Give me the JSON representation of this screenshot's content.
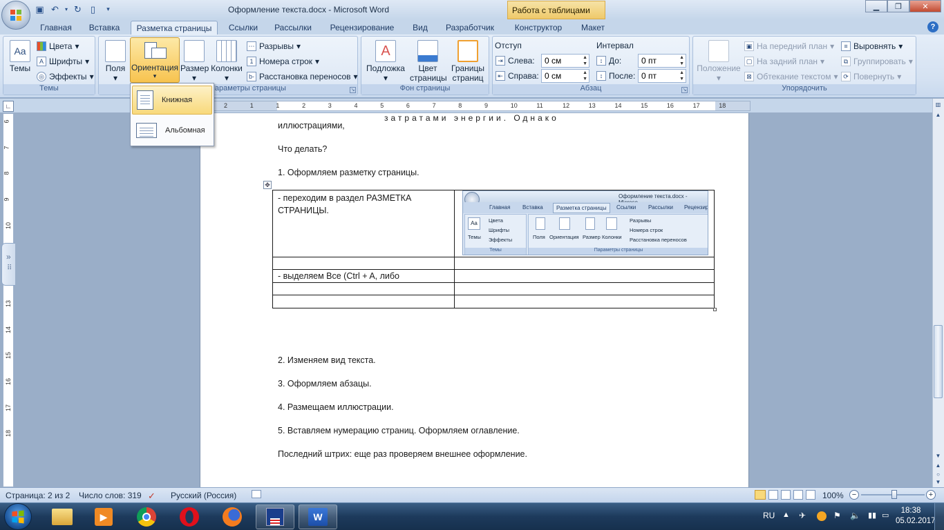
{
  "window": {
    "title": "Оформление текста.docx - Microsoft Word",
    "context_tab_title": "Работа с таблицами",
    "controls": [
      "minimize",
      "maximize",
      "close"
    ]
  },
  "quick_access": [
    "save-icon",
    "undo-icon",
    "redo-icon",
    "new-document-icon",
    "customize-icon"
  ],
  "tabs": [
    "Главная",
    "Вставка",
    "Разметка страницы",
    "Ссылки",
    "Рассылки",
    "Рецензирование",
    "Вид",
    "Разработчик",
    "Конструктор",
    "Макет"
  ],
  "active_tab": "Разметка страницы",
  "ribbon": {
    "themes": {
      "title": "Темы",
      "big": "Темы",
      "colors": "Цвета",
      "fonts": "Шрифты",
      "effects": "Эффекты"
    },
    "page_setup": {
      "title": "Параметры страницы",
      "fields": "Поля",
      "orientation": "Ориентация",
      "size": "Размер",
      "columns": "Колонки",
      "breaks": "Разрывы",
      "line_numbers": "Номера строк",
      "hyphenation": "Расстановка переносов"
    },
    "page_background": {
      "title": "Фон страницы",
      "watermark": "Подложка",
      "page_color": "Цвет страницы",
      "page_borders": "Границы страниц"
    },
    "paragraph": {
      "title": "Абзац",
      "indent_title": "Отступ",
      "left_label": "Слева:",
      "left_value": "0 см",
      "right_label": "Справа:",
      "right_value": "0 см",
      "spacing_title": "Интервал",
      "before_label": "До:",
      "before_value": "0 пт",
      "after_label": "После:",
      "after_value": "0 пт"
    },
    "arrange": {
      "title": "Упорядочить",
      "position": "Положение",
      "bring_front": "На передний план",
      "send_back": "На задний план",
      "text_wrap": "Обтекание текстом",
      "align": "Выровнять",
      "group": "Группировать",
      "rotate": "Повернуть"
    }
  },
  "orientation_menu": {
    "portrait": "Книжная",
    "landscape": "Альбомная"
  },
  "ruler": {
    "h_labels": [
      "2",
      "1",
      "1",
      "2",
      "3",
      "4",
      "5",
      "6",
      "7",
      "8",
      "9",
      "10",
      "11",
      "12",
      "13",
      "14",
      "15",
      "16",
      "17",
      "18"
    ],
    "v_labels": [
      "6",
      "7",
      "8",
      "9",
      "10",
      "11",
      "12",
      "13",
      "14",
      "15",
      "16",
      "17",
      "18"
    ]
  },
  "document": {
    "line_top_spaced": "затратами    энергии.    Однако",
    "line_illustrations": "иллюстрациями,",
    "what_to_do": "Что делать?",
    "item1": "1.  Оформляем  разметку страницы.",
    "table": {
      "r1c1": "- переходим в раздел РАЗМЕТКА СТРАНИЦЫ.",
      "r3c1": "- выделяем Все (Ctrl + A, либо"
    },
    "item2": "2.  Изменяем  вид текста.",
    "item3": "3. Оформляем  абзацы.",
    "item4": "4. Размещаем иллюстрации.",
    "item5": "5. Вставляем  нумерацию страниц. Оформляем оглавление.",
    "final": "Последний  штрих:  еще  раз проверяем  внешнее оформление."
  },
  "embedded_screenshot": {
    "title": "Оформление текста.docx - Microso",
    "tabs": [
      "Главная",
      "Вставка",
      "Разметка страницы",
      "Ссылки",
      "Рассылки",
      "Рецензир"
    ],
    "themes": "Темы",
    "colors": "Цвета",
    "fonts": "Шрифты",
    "effects": "Эффекты",
    "buttons": [
      "Поля",
      "Ориентация",
      "Размер",
      "Колонки"
    ],
    "breaks": "Разрывы",
    "line_numbers": "Номера строк",
    "hyphenation": "Расстановка переносов",
    "group_themes": "Темы",
    "group_page_setup": "Параметры страницы"
  },
  "status": {
    "page": "Страница: 2 из 2",
    "words": "Число слов: 319",
    "language": "Русский (Россия)",
    "zoom": "100%"
  },
  "taskbar": {
    "apps": [
      "explorer",
      "media-player",
      "chrome",
      "opera",
      "firefox",
      "save-app",
      "word"
    ],
    "lang": "RU",
    "time": "18:38",
    "date": "05.02.2017"
  },
  "colors": {
    "ribbon_bg": "#dbe6f4",
    "accent_highlight": "#f7c34f",
    "context_tab": "#efc96a",
    "taskbar": "#1d3a5c"
  }
}
